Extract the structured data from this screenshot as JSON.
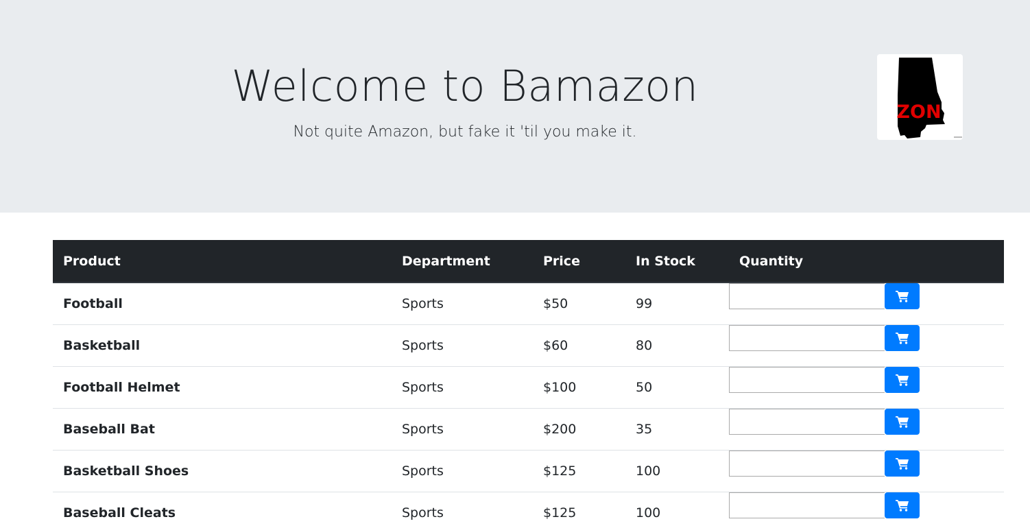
{
  "hero": {
    "title": "Welcome to Bamazon",
    "subtitle": "Not quite Amazon, but fake it 'til you make it.",
    "logo_text": "ZON"
  },
  "table": {
    "headers": [
      "Product",
      "Department",
      "Price",
      "In Stock",
      "Quantity"
    ],
    "rows": [
      {
        "product": "Football",
        "department": "Sports",
        "price": "$50",
        "stock": "99"
      },
      {
        "product": "Basketball",
        "department": "Sports",
        "price": "$60",
        "stock": "80"
      },
      {
        "product": "Football Helmet",
        "department": "Sports",
        "price": "$100",
        "stock": "50"
      },
      {
        "product": "Baseball Bat",
        "department": "Sports",
        "price": "$200",
        "stock": "35"
      },
      {
        "product": "Basketball Shoes",
        "department": "Sports",
        "price": "$125",
        "stock": "100"
      },
      {
        "product": "Baseball Cleats",
        "department": "Sports",
        "price": "$125",
        "stock": "100"
      }
    ],
    "quantity_value": "",
    "cart_icon": "shopping-cart-icon"
  },
  "colors": {
    "header_bg": "#212529",
    "jumbotron_bg": "#e9ecef",
    "button": "#007bff",
    "logo_red": "#e10000"
  }
}
